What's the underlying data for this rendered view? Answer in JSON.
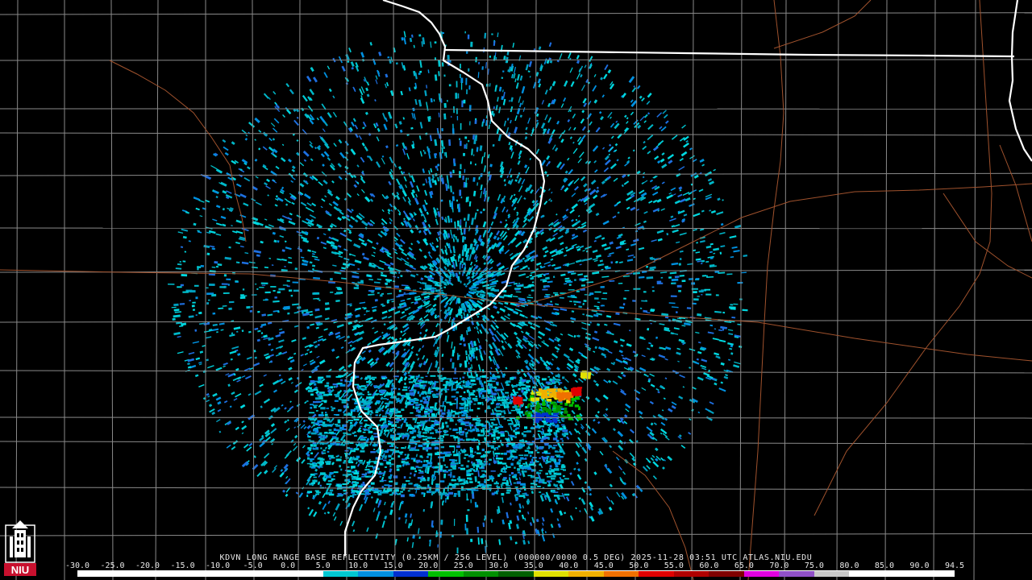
{
  "radar_product": {
    "site": "KDVN",
    "caption": "KDVN LONG RANGE BASE REFLECTIVITY (0.25KM / 256 LEVEL) (000000/0000 0.5 DEG) 2025-11-28 03:51 UTC  ATLAS.NIU.EDU"
  },
  "logo": {
    "text": "NIU",
    "icon": "university-tower-icon",
    "color": "#c8102e"
  },
  "color_scale": {
    "labels": [
      "-30.0",
      "-25.0",
      "-20.0",
      "-15.0",
      "-10.0",
      "-5.0",
      "0.0",
      "5.0",
      "10.0",
      "15.0",
      "20.0",
      "25.0",
      "30.0",
      "35.0",
      "40.0",
      "45.0",
      "50.0",
      "55.0",
      "60.0",
      "65.0",
      "70.0",
      "75.0",
      "80.0",
      "85.0",
      "90.0",
      "94.5"
    ],
    "colors": [
      "#000000",
      "#000000",
      "#000000",
      "#000000",
      "#000000",
      "#000000",
      "#000000",
      "#00c8d2",
      "#0090e0",
      "#0030d0",
      "#00c000",
      "#009000",
      "#006000",
      "#e0e000",
      "#f0b000",
      "#f07000",
      "#e00000",
      "#b00000",
      "#800000",
      "#e000e0",
      "#9050c8",
      "#c8c8c8",
      "#ffffff",
      "#ffffff",
      "#ffffff"
    ]
  },
  "map": {
    "state_border_color": "#ffffff",
    "county_line_color": "#8a8a8a",
    "highway_color": "#a0522d"
  }
}
